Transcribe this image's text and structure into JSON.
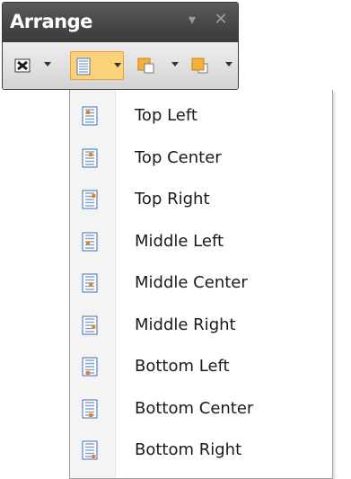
{
  "panel": {
    "title": "Arrange",
    "pin_icon": "pin-icon",
    "close_icon": "close-icon"
  },
  "toolbar": {
    "tools": [
      {
        "icon": "bring-forward-icon",
        "has_dropdown": true
      },
      {
        "icon": "text-alignment-icon",
        "has_dropdown": true,
        "active": true
      },
      {
        "icon": "bring-to-front-icon",
        "has_dropdown": true
      },
      {
        "icon": "send-to-back-icon",
        "has_dropdown": true
      }
    ]
  },
  "menu": {
    "items": [
      {
        "label": "Top Left",
        "icon": "align-top-left-icon"
      },
      {
        "label": "Top Center",
        "icon": "align-top-center-icon"
      },
      {
        "label": "Top Right",
        "icon": "align-top-right-icon"
      },
      {
        "label": "Middle Left",
        "icon": "align-middle-left-icon"
      },
      {
        "label": "Middle Center",
        "icon": "align-middle-center-icon"
      },
      {
        "label": "Middle Right",
        "icon": "align-middle-right-icon"
      },
      {
        "label": "Bottom Left",
        "icon": "align-bottom-left-icon"
      },
      {
        "label": "Bottom Center",
        "icon": "align-bottom-center-icon"
      },
      {
        "label": "Bottom Right",
        "icon": "align-bottom-right-icon"
      }
    ]
  },
  "colors": {
    "titlebar": "#474747",
    "active_tool": "#fbd27a",
    "icon_accent": "#e8801e",
    "icon_blue": "#3a6fb0"
  }
}
